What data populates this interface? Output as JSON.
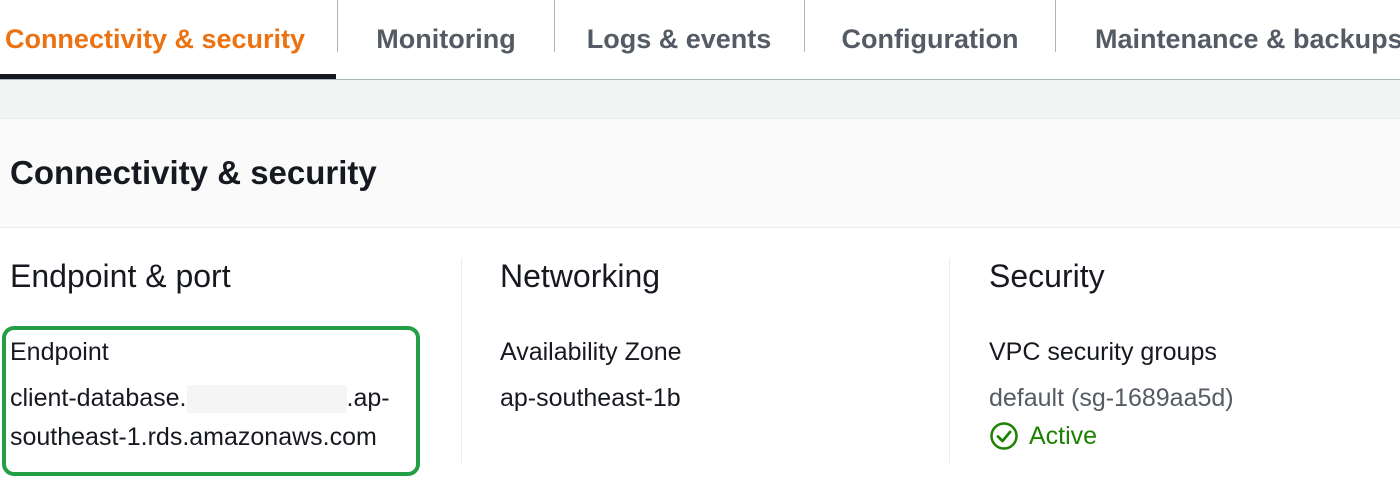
{
  "tabs": [
    {
      "label": "Connectivity & security",
      "active": true
    },
    {
      "label": "Monitoring",
      "active": false
    },
    {
      "label": "Logs & events",
      "active": false
    },
    {
      "label": "Configuration",
      "active": false
    },
    {
      "label": "Maintenance & backups",
      "active": false
    }
  ],
  "panel": {
    "title": "Connectivity & security"
  },
  "endpoint_port": {
    "heading": "Endpoint & port",
    "endpoint_label": "Endpoint",
    "endpoint_prefix": "client-database.",
    "endpoint_suffix_line1": ".ap-",
    "endpoint_line2": "southeast-1.rds.amazonaws.com"
  },
  "networking": {
    "heading": "Networking",
    "az_label": "Availability Zone",
    "az_value": "ap-southeast-1b"
  },
  "security": {
    "heading": "Security",
    "sg_label": "VPC security groups",
    "sg_link": "default (sg-1689aa5d)",
    "sg_status": "Active"
  },
  "colors": {
    "active_tab": "#ec7211",
    "highlight_box": "#23a046",
    "status_active": "#1d8102",
    "link": "#545b64"
  },
  "icons": {
    "status": "check-circle-icon"
  }
}
